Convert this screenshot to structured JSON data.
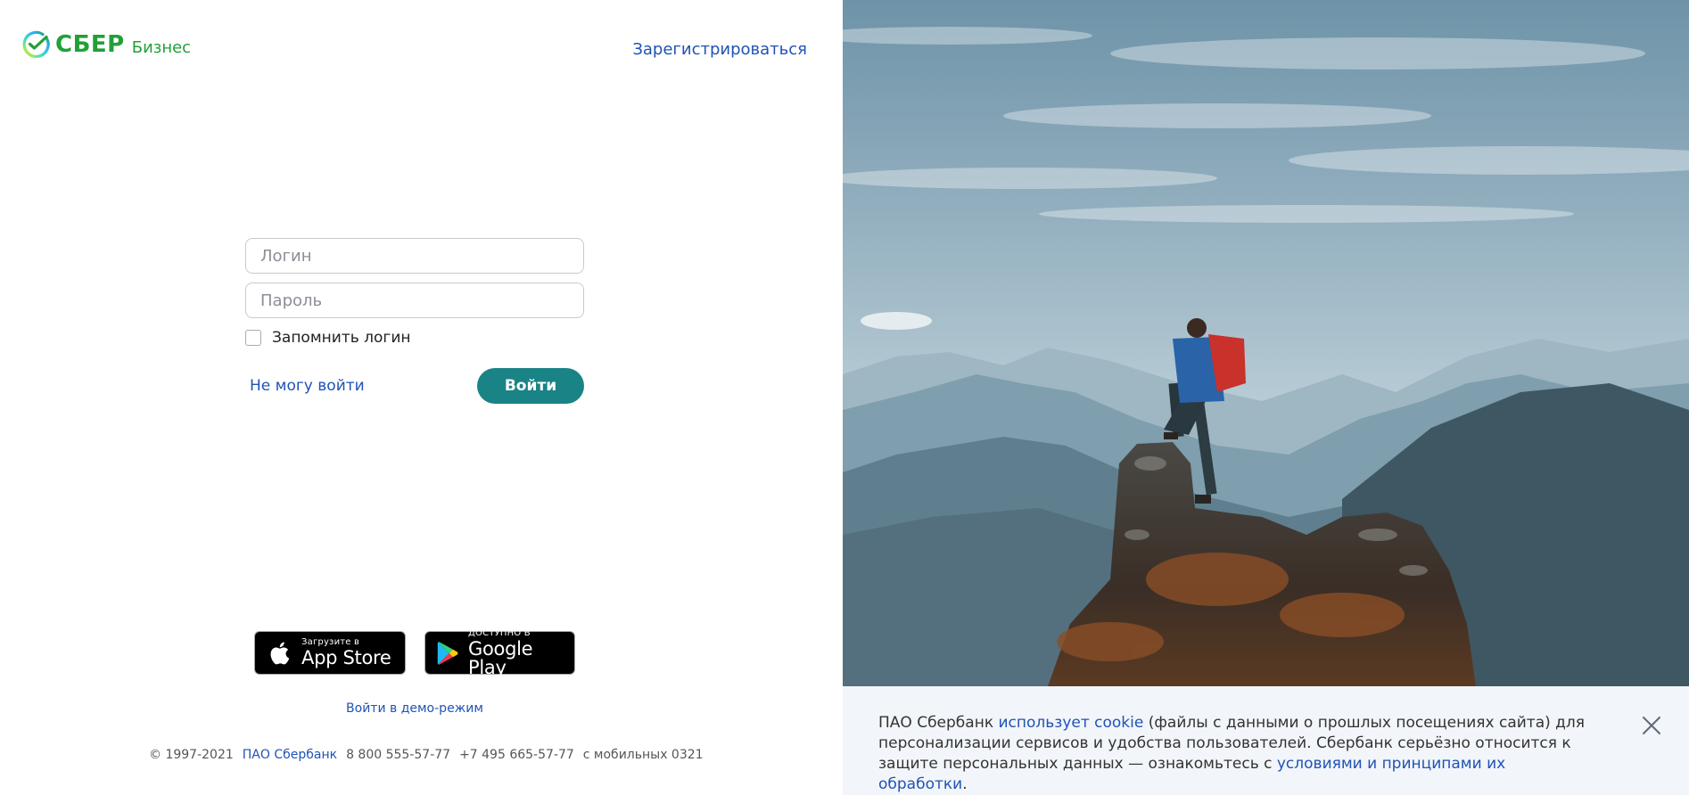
{
  "brand": {
    "name": "СБЕР",
    "product": "Бизнес",
    "color": "#21a038"
  },
  "header": {
    "register_link": "Зарегистрироваться"
  },
  "login_form": {
    "login_placeholder": "Логин",
    "password_placeholder": "Пароль",
    "remember_label": "Запомнить логин",
    "remember_checked": false,
    "cant_login_link": "Не могу войти",
    "submit_label": "Войти"
  },
  "store_badges": {
    "apple": {
      "small": "Загрузите в",
      "big": "App Store",
      "icon": "apple-icon"
    },
    "google": {
      "small": "ДОСТУПНО В",
      "big": "Google Play",
      "icon": "google-play-icon"
    }
  },
  "demo_link": "Войти в демо-режим",
  "footer": {
    "copyright": "© 1997-2021",
    "company_link": "ПАО Сбербанк",
    "phone1": "8 800 555-57-77",
    "phone2": "+7 495 665-57-77",
    "mobile": "с мобильных 0321"
  },
  "cookie_banner": {
    "part1": "ПАО Сбербанк ",
    "link1": "использует cookie",
    "part2": " (файлы с данными о прошлых посещениях сайта) для персонализации сервисов и удобства пользователей. Сбербанк серьёзно относится к защите персональных данных — ознакомьтесь с ",
    "link2": "условиями и принципами их обработки",
    "part3": "."
  },
  "colors": {
    "accent": "#1a8386",
    "link": "#1f53b5",
    "cookie_bg": "#f2f5f9"
  }
}
